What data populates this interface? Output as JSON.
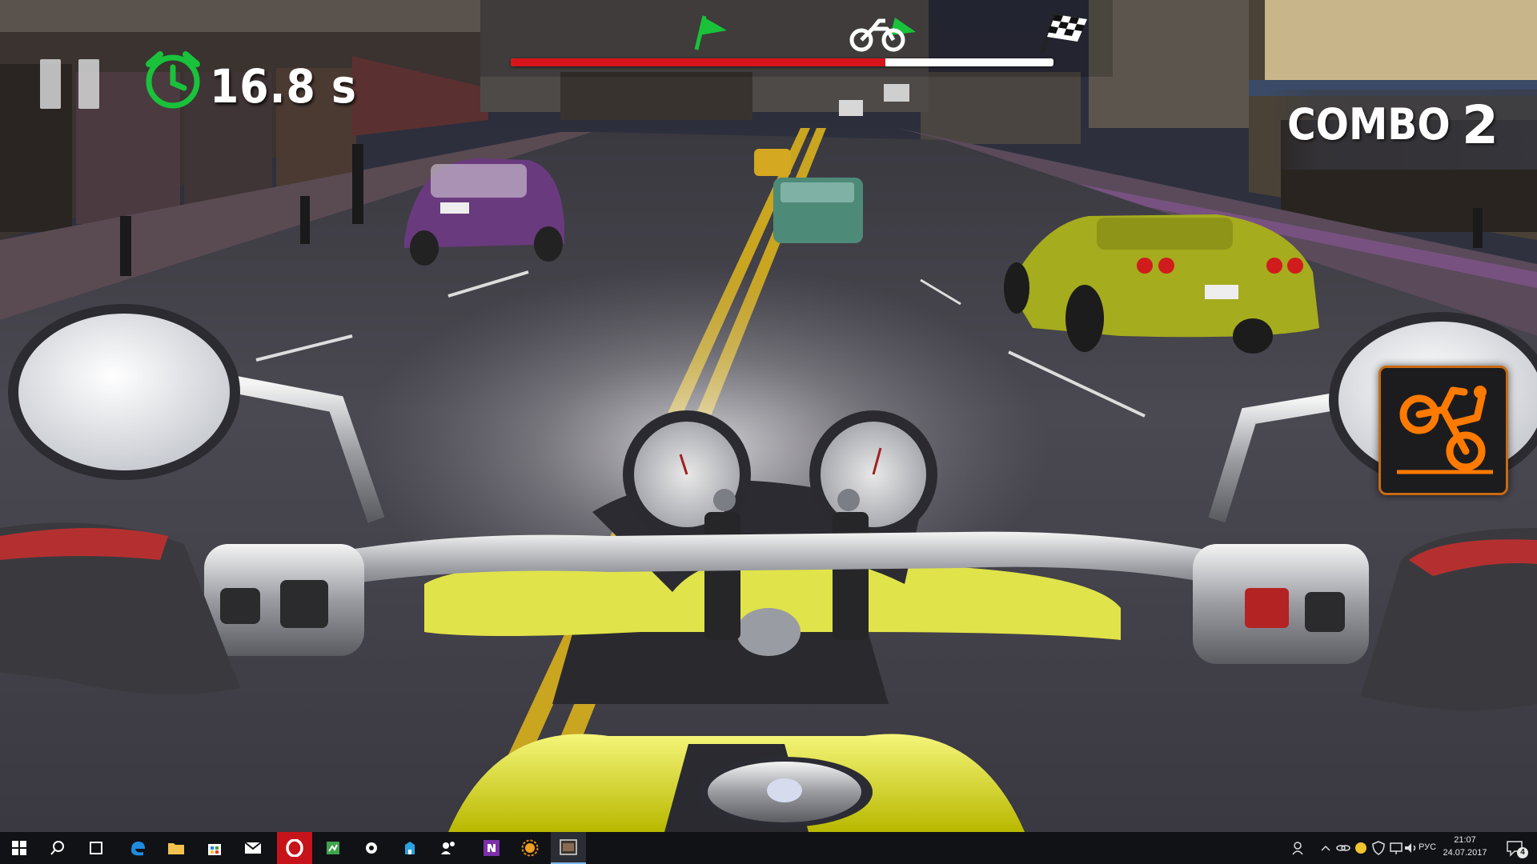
{
  "hud": {
    "timer_text": "16.8 s",
    "combo_label": "COMBO",
    "combo_value": "2",
    "race_progress": 0.69
  },
  "icons": {
    "pause": "pause-icon",
    "timer": "stopwatch-icon",
    "start_flag": "green-flag-icon",
    "player_marker": "motorbike-icon",
    "finish_flag": "checkered-flag-icon",
    "wheelie": "wheelie-icon"
  },
  "colors": {
    "progress_fill": "#d7141a",
    "progress_track": "#ffffff",
    "timer_green": "#19c23a",
    "wheelie_orange": "#ff7a00",
    "bike_yellow": "#e6e600"
  },
  "taskbar": {
    "language": "РУС",
    "time": "21:07",
    "date": "24.07.2017",
    "notifications_count": "4",
    "apps": [
      "start-icon",
      "search-icon",
      "task-view-icon",
      "edge-icon",
      "file-explorer-icon",
      "store-icon",
      "mail-icon",
      "opera-icon",
      "app-icon",
      "settings-icon",
      "app-icon",
      "people-icon",
      "onenote-icon",
      "sun-app-icon",
      "game-app-icon"
    ]
  }
}
